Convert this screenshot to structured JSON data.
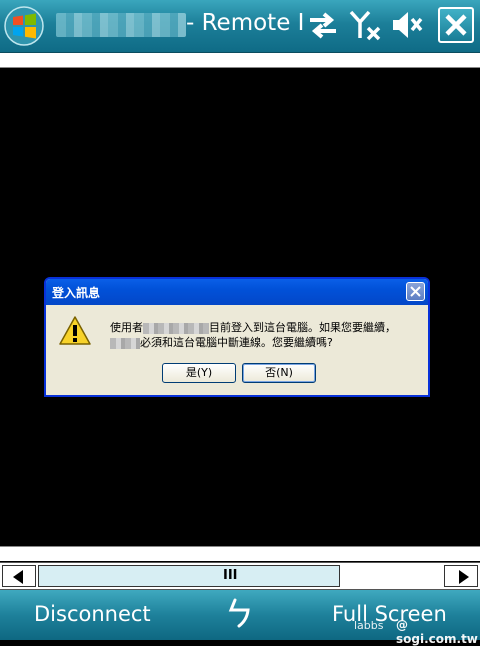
{
  "titlebar": {
    "title_suffix": "- Remote I",
    "icons": [
      "windows-start-icon",
      "connectivity-icon",
      "signal-off-icon",
      "volume-mute-icon",
      "close-icon"
    ]
  },
  "dialog": {
    "title": "登入訊息",
    "message_line1_before": "使用者",
    "message_line1_after": "目前登入到這台電腦。如果您要繼續，",
    "message_line2_after": "必須和這台電腦中斷連線。您要繼續嗎?",
    "yes_button": "是(Y)",
    "no_button": "否(N)"
  },
  "scrollbar": {
    "grip": "III"
  },
  "softkeys": {
    "left": "Disconnect",
    "right": "Full Screen"
  },
  "watermark": {
    "left": "labbs",
    "right": "@ sogi.com.tw"
  },
  "colors": {
    "titlebar": "#1c7f99",
    "dialog_title": "#0151d8",
    "dialog_body": "#ece9d8"
  }
}
